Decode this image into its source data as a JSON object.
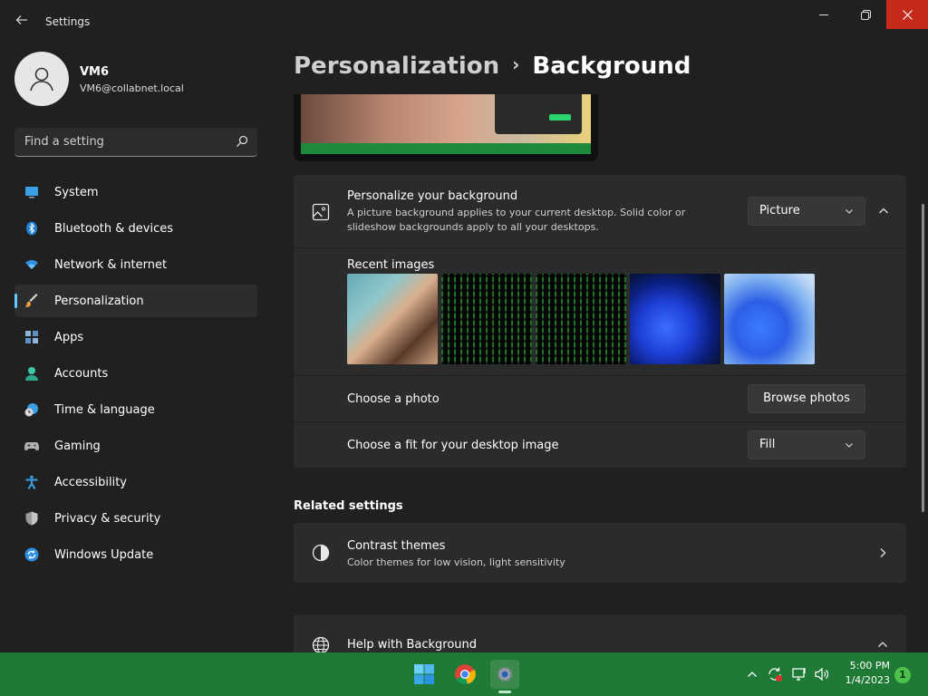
{
  "window": {
    "title": "Settings"
  },
  "user": {
    "name": "VM6",
    "email": "VM6@collabnet.local"
  },
  "search": {
    "placeholder": "Find a setting"
  },
  "sidebar": {
    "items": [
      {
        "label": "System",
        "icon": "system-icon"
      },
      {
        "label": "Bluetooth & devices",
        "icon": "bluetooth-icon"
      },
      {
        "label": "Network & internet",
        "icon": "wifi-icon"
      },
      {
        "label": "Personalization",
        "icon": "brush-icon",
        "active": true
      },
      {
        "label": "Apps",
        "icon": "apps-icon"
      },
      {
        "label": "Accounts",
        "icon": "accounts-icon"
      },
      {
        "label": "Time & language",
        "icon": "time-language-icon"
      },
      {
        "label": "Gaming",
        "icon": "gaming-icon"
      },
      {
        "label": "Accessibility",
        "icon": "accessibility-icon"
      },
      {
        "label": "Privacy & security",
        "icon": "shield-icon"
      },
      {
        "label": "Windows Update",
        "icon": "windows-update-icon"
      }
    ]
  },
  "breadcrumb": {
    "parent": "Personalization",
    "separator": "›",
    "current": "Background"
  },
  "background_card": {
    "title": "Personalize your background",
    "description": "A picture background applies to your current desktop. Solid color or slideshow backgrounds apply to all your desktops.",
    "type_value": "Picture",
    "recent_images_label": "Recent images",
    "choose_photo_label": "Choose a photo",
    "browse_button": "Browse photos",
    "fit_label": "Choose a fit for your desktop image",
    "fit_value": "Fill"
  },
  "related": {
    "heading": "Related settings",
    "contrast_title": "Contrast themes",
    "contrast_desc": "Color themes for low vision, light sensitivity"
  },
  "help": {
    "title": "Help with Background"
  },
  "taskbar": {
    "time": "5:00 PM",
    "date": "1/4/2023",
    "notification_count": "1"
  },
  "colors": {
    "accent": "#60cdff",
    "taskbar": "#1e7a34",
    "close_button": "#c42b1c",
    "background": "#202020",
    "card": "#2b2b2b"
  }
}
